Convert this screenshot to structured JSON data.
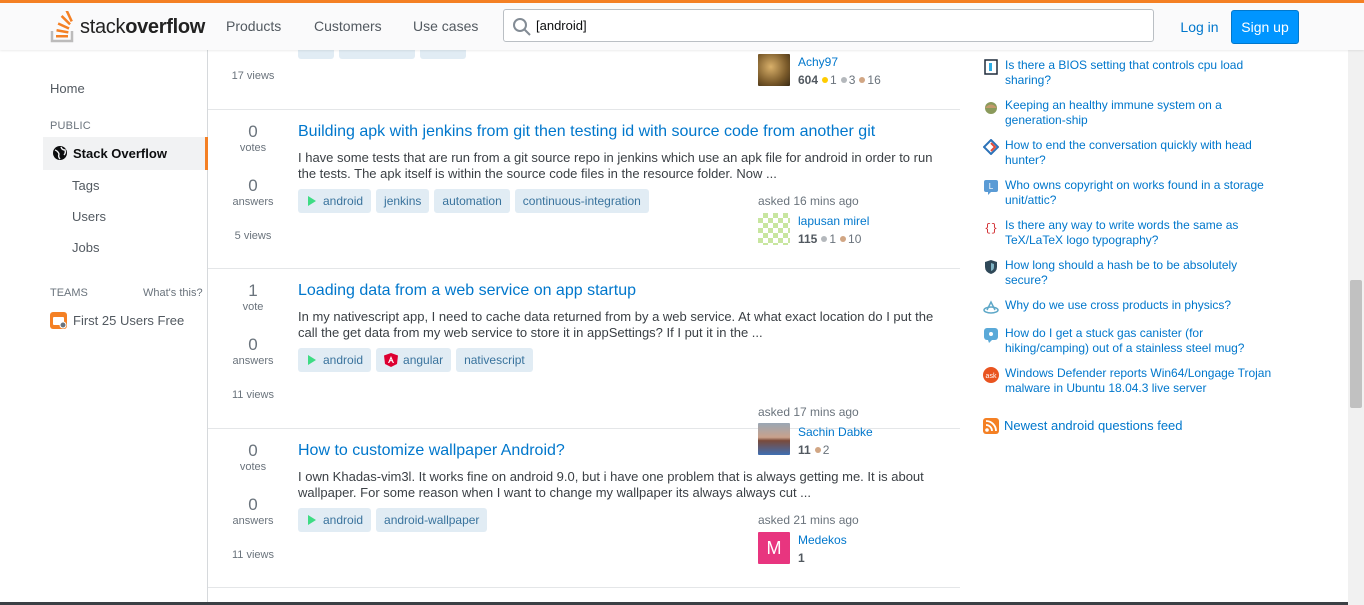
{
  "header": {
    "logo_plain": "stack",
    "logo_bold": "overflow",
    "nav": [
      "Products",
      "Customers",
      "Use cases"
    ],
    "search_value": "[android]",
    "login_label": "Log in",
    "signup_label": "Sign up"
  },
  "sidebar": {
    "home": "Home",
    "public_heading": "PUBLIC",
    "stack_overflow": "Stack Overflow",
    "tags": "Tags",
    "users": "Users",
    "jobs": "Jobs",
    "teams_heading": "TEAMS",
    "whats_this": "What's this?",
    "first_users": "First 25 Users Free"
  },
  "top_partial": {
    "views": "17 views",
    "user_name": "Achy97",
    "rep": "604",
    "gold": "1",
    "silver": "3",
    "bronze": "16"
  },
  "questions": [
    {
      "votes": "0",
      "votes_label": "votes",
      "answers": "0",
      "answers_label": "answers",
      "views": "5 views",
      "title": "Building apk with jenkins from git then testing id with source code from another git",
      "excerpt": "I have some tests that are run from a git source repo in jenkins which use an apk file for android in order to run the tests. The apk itself is within the source code files in the resource folder. Now ...",
      "tags": [
        "android",
        "jenkins",
        "automation",
        "continuous-integration"
      ],
      "asked": "asked 16 mins ago",
      "user_name": "lapusan mirel",
      "rep": "115",
      "silver": "1",
      "bronze": "10"
    },
    {
      "votes": "1",
      "votes_label": "vote",
      "answers": "0",
      "answers_label": "answers",
      "views": "11 views",
      "title": "Loading data from a web service on app startup",
      "excerpt": "In my nativescript app, I need to cache data returned from by a web service. At what exact location do I put the call the get data from my web service to store it in appSettings? If I put it in the ...",
      "tags": [
        "android",
        "angular",
        "nativescript"
      ],
      "asked": "asked 17 mins ago",
      "user_name": "Sachin Dabke",
      "rep": "11",
      "bronze": "2"
    },
    {
      "votes": "0",
      "votes_label": "votes",
      "answers": "0",
      "answers_label": "answers",
      "views": "11 views",
      "title": "How to customize wallpaper Android?",
      "excerpt": "I own Khadas-vim3l. It works fine on android 9.0, but i have one problem that is always getting me. It is about wallpaper. For some reason when I want to change my wallpaper its always always cut ...",
      "tags": [
        "android",
        "android-wallpaper"
      ],
      "asked": "asked 21 mins ago",
      "user_name": "Medekos",
      "avatar_letter": "M",
      "rep": "1"
    }
  ],
  "hot_questions": [
    "Is there a BIOS setting that controls cpu load sharing?",
    "Keeping an healthy immune system on a generation-ship",
    "How to end the conversation quickly with head hunter?",
    "Who owns copyright on works found in a storage unit/attic?",
    "Is there any way to write words the same as TeX/LaTeX logo typography?",
    "How long should a hash be to be absolutely secure?",
    "Why do we use cross products in physics?",
    "How do I get a stuck gas canister (for hiking/camping) out of a stainless steel mug?",
    "Windows Defender reports Win64/Longage Trojan malware in Ubuntu 18.04.3 live server"
  ],
  "feed_label": "Newest android questions feed",
  "colors": {
    "accent": "#f48024",
    "link": "#0077cc",
    "tag_bg": "#e1ecf4",
    "tag_text": "#39739d",
    "primary_button": "#0095ff"
  }
}
